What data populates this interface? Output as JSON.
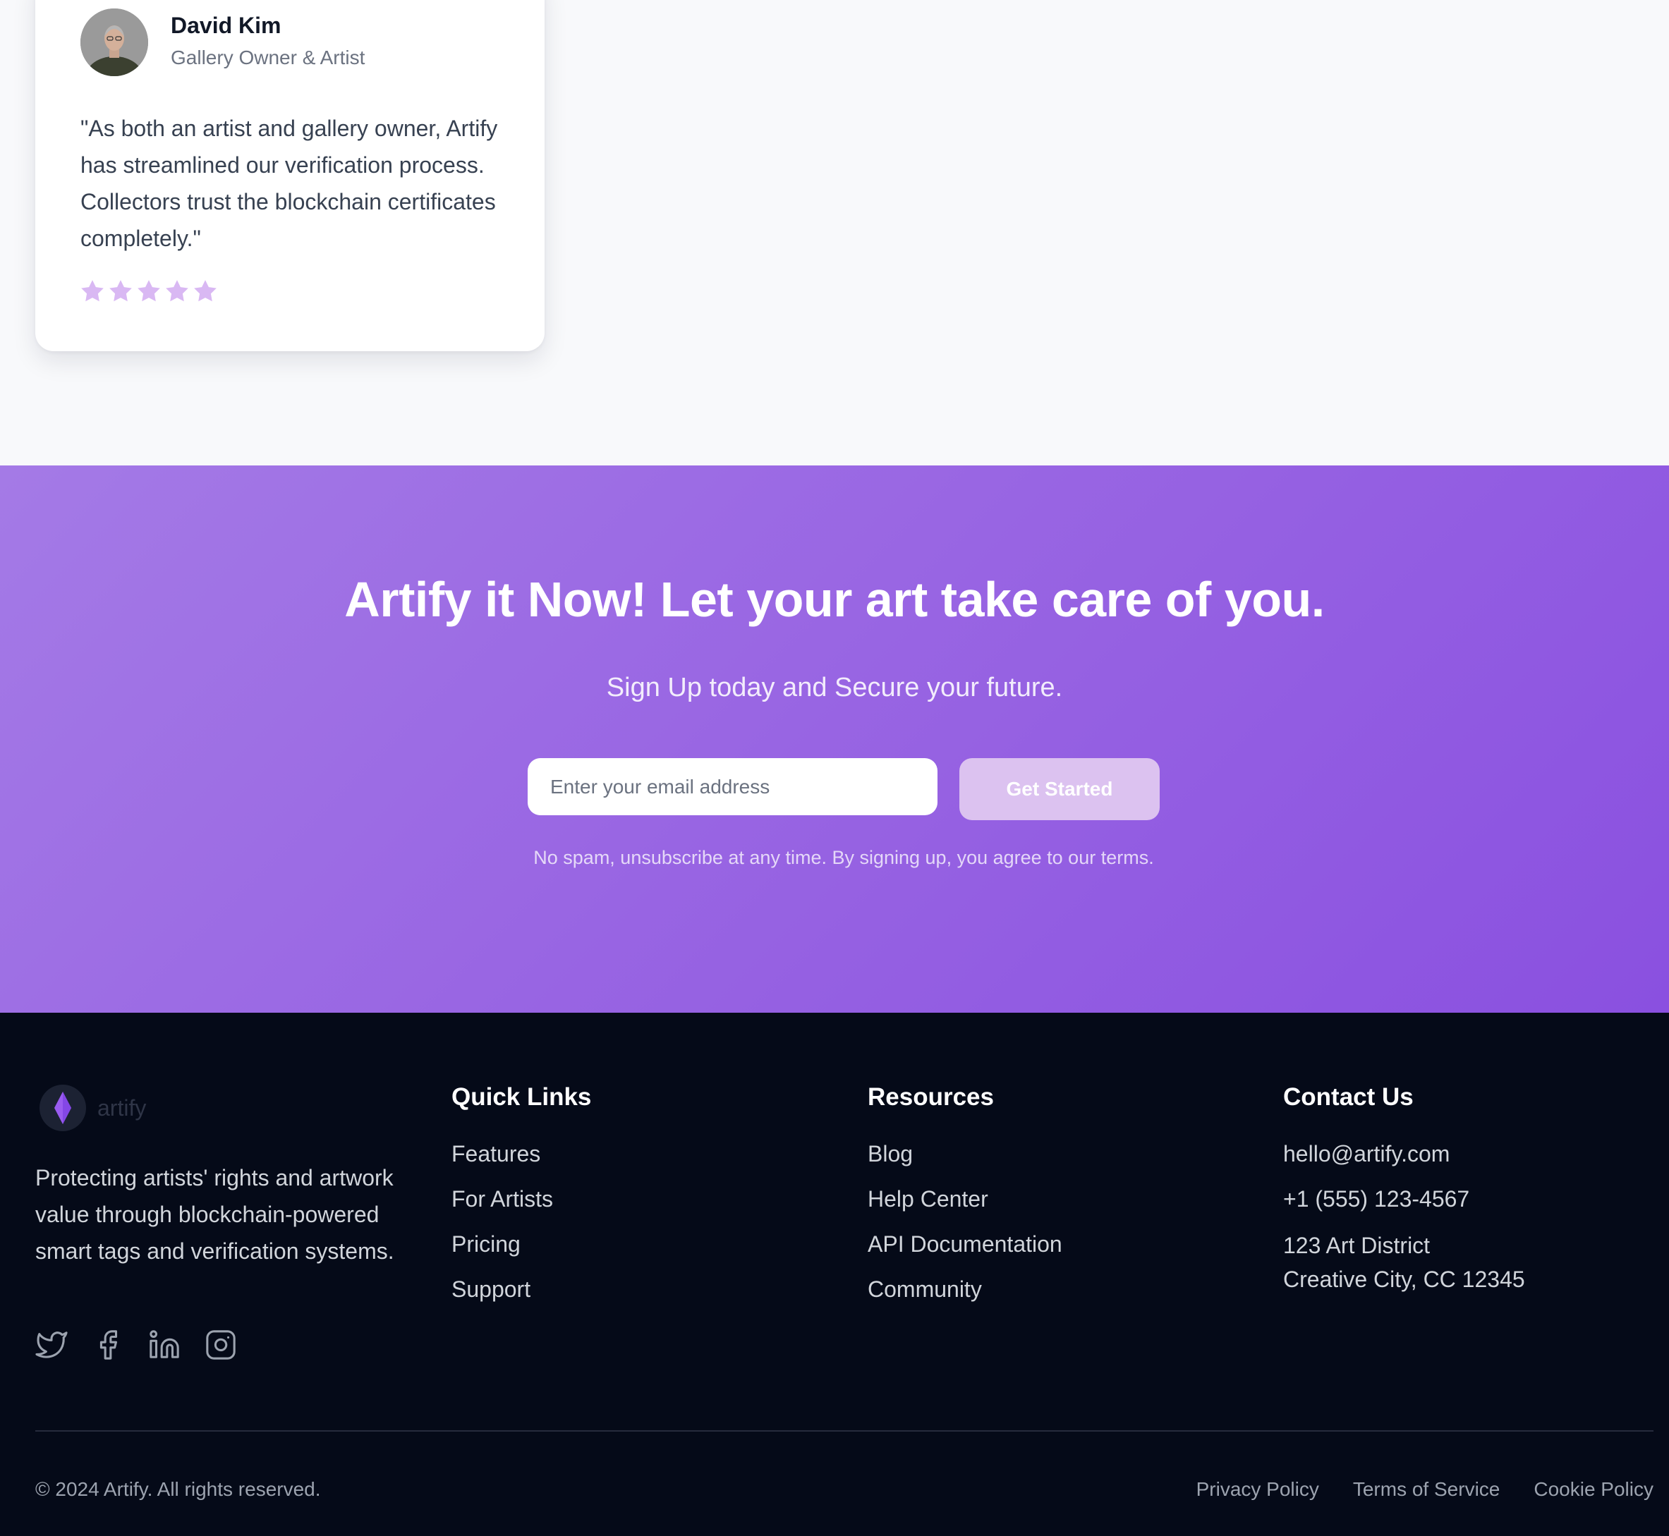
{
  "testimonial": {
    "name": "David Kim",
    "role": "Gallery Owner & Artist",
    "quote": "\"As both an artist and gallery owner, Artify has streamlined our verification process. Collectors trust the blockchain certificates completely.\"",
    "rating": 5,
    "star_color": "#d9b8f3"
  },
  "cta": {
    "title": "Artify it Now! Let your art take care of you.",
    "subtitle": "Sign Up today and Secure your future.",
    "email_placeholder": "Enter your email address",
    "button_label": "Get Started",
    "note": "No spam, unsubscribe at any time. By signing up, you agree to our terms.",
    "gradient_start": "#a47ae6",
    "gradient_end": "#8a50e0"
  },
  "footer": {
    "brand": {
      "name": "artify",
      "logo_icon": "diamond-icon",
      "description": "Protecting artists' rights and artwork value through blockchain-powered smart tags and verification systems."
    },
    "socials": [
      "twitter-icon",
      "facebook-icon",
      "linkedin-icon",
      "instagram-icon"
    ],
    "quick_links": {
      "title": "Quick Links",
      "items": [
        "Features",
        "For Artists",
        "Pricing",
        "Support"
      ]
    },
    "resources": {
      "title": "Resources",
      "items": [
        "Blog",
        "Help Center",
        "API Documentation",
        "Community"
      ]
    },
    "contact": {
      "title": "Contact Us",
      "email": "hello@artify.com",
      "phone": "+1 (555) 123-4567",
      "address_line1": "123 Art District",
      "address_line2": "Creative City, CC 12345"
    },
    "copyright": "© 2024 Artify. All rights reserved.",
    "legal": [
      "Privacy Policy",
      "Terms of Service",
      "Cookie Policy"
    ]
  }
}
